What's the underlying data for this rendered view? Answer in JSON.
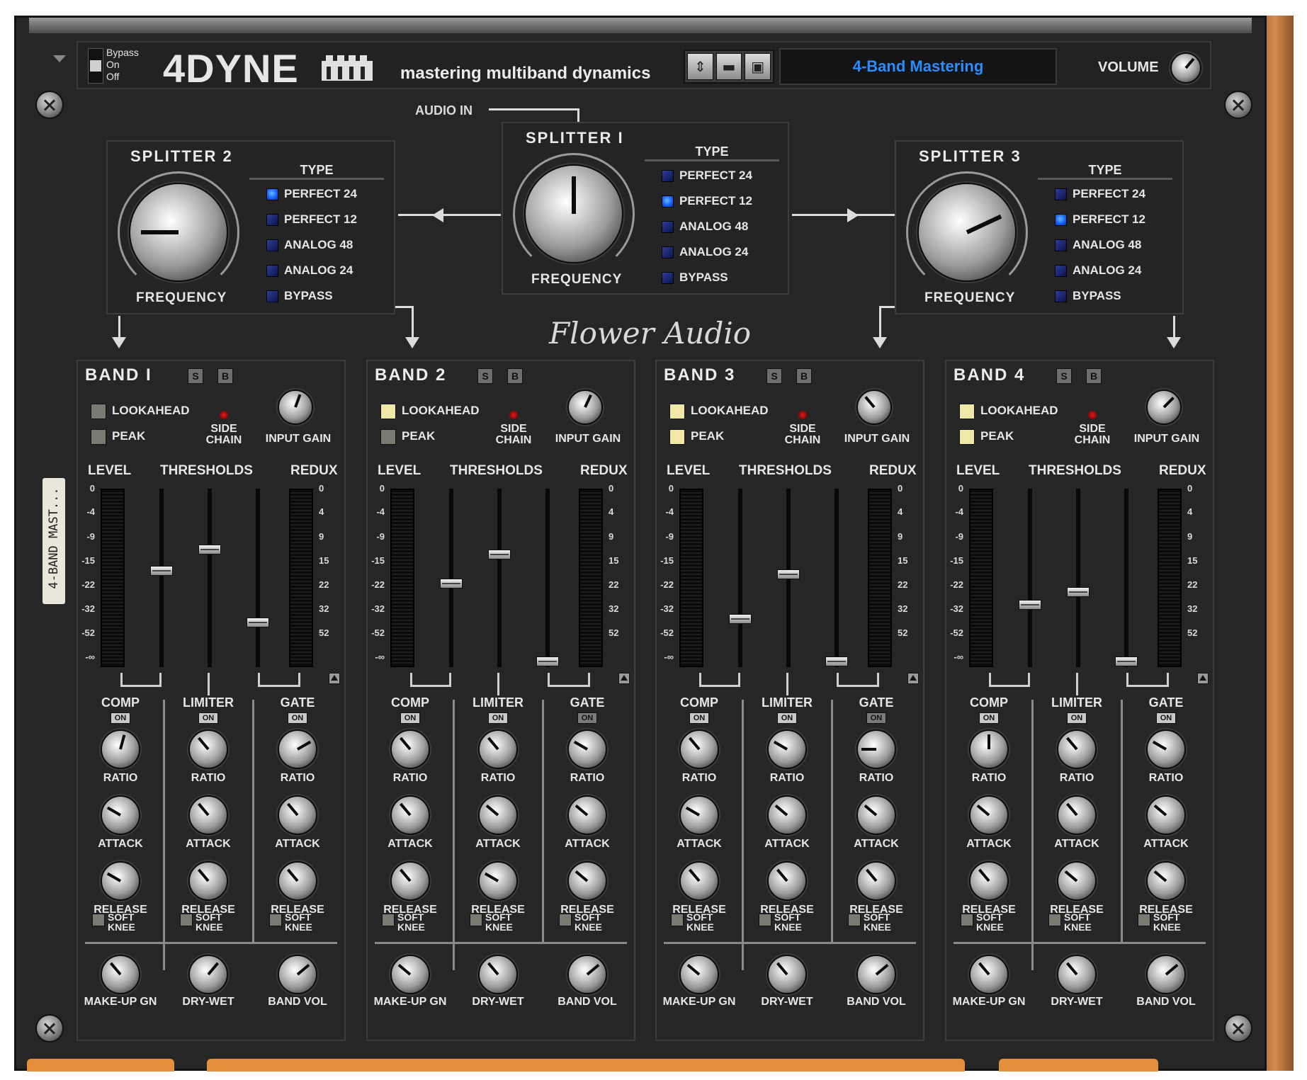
{
  "header": {
    "bypass_labels": [
      "Bypass",
      "On",
      "Off"
    ],
    "logo": "4DYNE",
    "tagline": "mastering multiband dynamics",
    "preset_name": "4-Band Mastering",
    "volume_label": "VOLUME",
    "volume_knob_angle": 40,
    "preset_buttons": [
      "preset-arrows-icon",
      "folder-icon",
      "save-icon"
    ]
  },
  "routing": {
    "audio_in": "AUDIO IN"
  },
  "brand": "Flower Audio",
  "patch_label": "4-BAND MAST...",
  "splitters": [
    {
      "title": "SPLITTER 2",
      "type_label": "TYPE",
      "freq_label": "FREQUENCY",
      "knob_angle": -90,
      "options": [
        {
          "label": "PERFECT 24",
          "on": true
        },
        {
          "label": "PERFECT 12",
          "on": false
        },
        {
          "label": "ANALOG 48",
          "on": false
        },
        {
          "label": "ANALOG 24",
          "on": false
        },
        {
          "label": "BYPASS",
          "on": false
        }
      ]
    },
    {
      "title": "SPLITTER I",
      "type_label": "TYPE",
      "freq_label": "FREQUENCY",
      "knob_angle": 0,
      "options": [
        {
          "label": "PERFECT 24",
          "on": false
        },
        {
          "label": "PERFECT 12",
          "on": true
        },
        {
          "label": "ANALOG 48",
          "on": false
        },
        {
          "label": "ANALOG 24",
          "on": false
        },
        {
          "label": "BYPASS",
          "on": false
        }
      ]
    },
    {
      "title": "SPLITTER 3",
      "type_label": "TYPE",
      "freq_label": "FREQUENCY",
      "knob_angle": 65,
      "options": [
        {
          "label": "PERFECT 24",
          "on": false
        },
        {
          "label": "PERFECT 12",
          "on": true
        },
        {
          "label": "ANALOG 48",
          "on": false
        },
        {
          "label": "ANALOG 24",
          "on": false
        },
        {
          "label": "BYPASS",
          "on": false
        }
      ]
    }
  ],
  "band_labels": {
    "solo": "S",
    "bypass": "B",
    "lookahead": "LOOKAHEAD",
    "peak": "PEAK",
    "side_chain": [
      "SIDE",
      "CHAIN"
    ],
    "input_gain": "INPUT GAIN",
    "level": "LEVEL",
    "thresholds": "THRESHOLDS",
    "redux": "REDUX",
    "comp": "COMP",
    "limiter": "LIMITER",
    "gate": "GATE",
    "on": "ON",
    "ratio": "RATIO",
    "attack": "ATTACK",
    "release": "RELEASE",
    "soft_knee": [
      "SOFT",
      "KNEE"
    ],
    "makeup_gain": "MAKE-UP GN",
    "dry_wet": "DRY-WET",
    "band_vol": "BAND VOL",
    "meter_scale": [
      "0",
      "-4",
      "-9",
      "-15",
      "-22",
      "-32",
      "-52",
      "-∞"
    ],
    "redux_scale": [
      "0",
      "4",
      "9",
      "15",
      "22",
      "32",
      "52"
    ]
  },
  "bands": [
    {
      "title": "BAND I",
      "lookahead": false,
      "peak": false,
      "input_gain_angle": 20,
      "thresholds": {
        "comp": 0.46,
        "limiter": 0.34,
        "gate": 0.75
      },
      "gate_on": true,
      "knobs": {
        "comp": [
          15,
          -60,
          -60
        ],
        "limiter": [
          -40,
          -40,
          -40
        ],
        "gate": [
          60,
          -40,
          -40
        ],
        "bottom": [
          -40,
          40,
          50
        ]
      }
    },
    {
      "title": "BAND 2",
      "lookahead": true,
      "peak": false,
      "input_gain_angle": 25,
      "thresholds": {
        "comp": 0.53,
        "limiter": 0.37,
        "gate": 0.97
      },
      "gate_on": false,
      "knobs": {
        "comp": [
          -40,
          -40,
          -40
        ],
        "limiter": [
          -40,
          -50,
          -60
        ],
        "gate": [
          -60,
          -50,
          -50
        ],
        "bottom": [
          -50,
          -40,
          50
        ]
      }
    },
    {
      "title": "BAND 3",
      "lookahead": true,
      "peak": true,
      "input_gain_angle": -40,
      "thresholds": {
        "comp": 0.73,
        "limiter": 0.48,
        "gate": 0.97
      },
      "gate_on": false,
      "knobs": {
        "comp": [
          -40,
          -60,
          -40
        ],
        "limiter": [
          -60,
          -50,
          -40
        ],
        "gate": [
          -90,
          -50,
          -40
        ],
        "bottom": [
          -50,
          -40,
          50
        ]
      }
    },
    {
      "title": "BAND 4",
      "lookahead": true,
      "peak": true,
      "input_gain_angle": 45,
      "thresholds": {
        "comp": 0.65,
        "limiter": 0.58,
        "gate": 0.97
      },
      "gate_on": true,
      "knobs": {
        "comp": [
          0,
          -50,
          -40
        ],
        "limiter": [
          -40,
          -40,
          -50
        ],
        "gate": [
          -60,
          -50,
          -50
        ],
        "bottom": [
          -40,
          -40,
          50
        ]
      }
    }
  ]
}
